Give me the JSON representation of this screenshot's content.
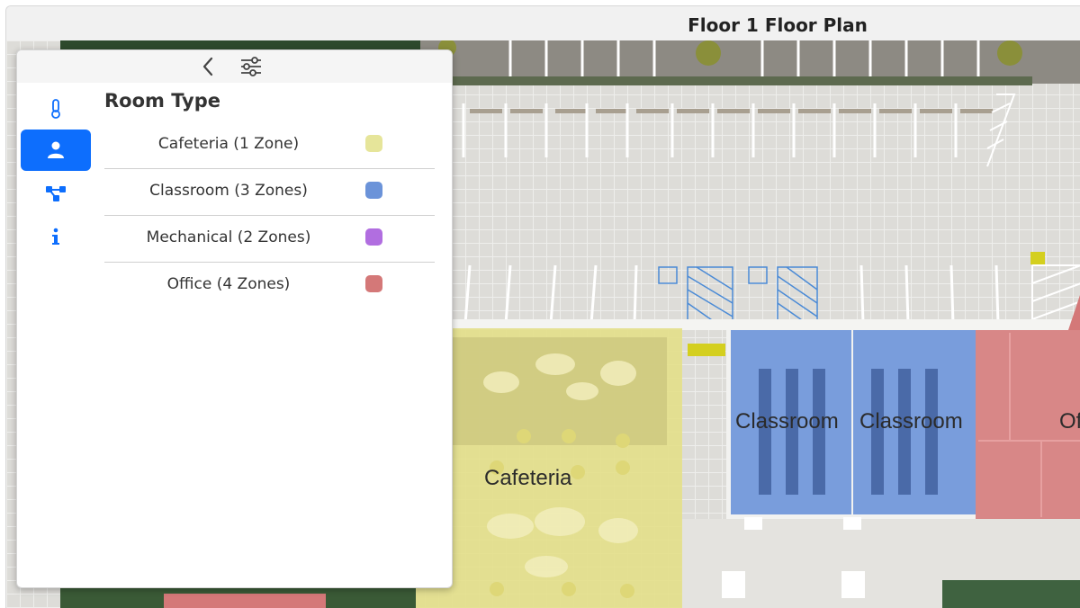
{
  "header": {
    "title": "Floor 1 Floor Plan"
  },
  "panel": {
    "back_icon": "chevron-left-icon",
    "filter_icon": "sliders-icon",
    "rail": [
      {
        "icon": "thermometer-icon",
        "active": false
      },
      {
        "icon": "person-icon",
        "active": true
      },
      {
        "icon": "network-icon",
        "active": false
      },
      {
        "icon": "info-icon",
        "active": false
      }
    ],
    "section_title": "Room Type",
    "legend": [
      {
        "label": "Cafeteria (1 Zone)",
        "color": "#e6e59a"
      },
      {
        "label": "Classroom (3 Zones)",
        "color": "#6b93d9"
      },
      {
        "label": "Mechanical (2 Zones)",
        "color": "#b16ee0"
      },
      {
        "label": "Office (4 Zones)",
        "color": "#d47878"
      }
    ]
  },
  "map": {
    "labels": {
      "cafeteria": "Cafeteria",
      "classroom_1": "Classroom",
      "classroom_2": "Classroom",
      "office_partial": "Of"
    },
    "accessible_icon": "wheelchair-icon"
  }
}
